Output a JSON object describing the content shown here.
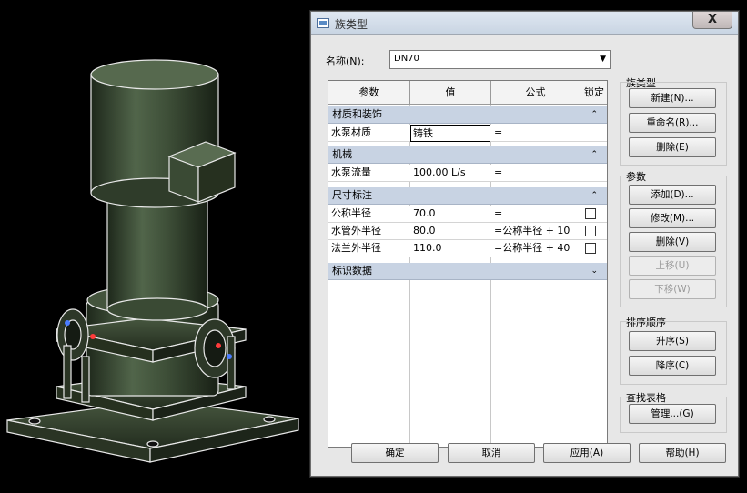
{
  "dialog": {
    "title": "族类型",
    "close_label": "X",
    "name_label": "名称(N):",
    "name_value": "DN70"
  },
  "grid": {
    "headers": [
      "参数",
      "值",
      "公式",
      "锁定"
    ],
    "groups": [
      {
        "label": "材质和装饰",
        "caret": "⌃"
      },
      {
        "label": "机械",
        "caret": "⌃"
      },
      {
        "label": "尺寸标注",
        "caret": "⌃"
      },
      {
        "label": "标识数据",
        "caret": "⌄"
      }
    ],
    "rows": [
      {
        "param": "水泵材质",
        "value": "铸铁",
        "formula": "="
      },
      {
        "param": "水泵流量",
        "value": "100.00 L/s",
        "formula": "="
      },
      {
        "param": "公称半径",
        "value": "70.0",
        "formula": "="
      },
      {
        "param": "水管外半径",
        "value": "80.0",
        "formula": "=公称半径 + 10"
      },
      {
        "param": "法兰外半径",
        "value": "110.0",
        "formula": "=公称半径 + 40"
      }
    ]
  },
  "side": {
    "family_types_label": "族类型",
    "new_label": "新建(N)...",
    "rename_label": "重命名(R)...",
    "delete_label": "删除(E)",
    "params_label": "参数",
    "add_label": "添加(D)...",
    "modify_label": "修改(M)...",
    "remove_label": "删除(V)",
    "move_up_label": "上移(U)",
    "move_down_label": "下移(W)",
    "sort_label": "排序顺序",
    "asc_label": "升序(S)",
    "desc_label": "降序(C)",
    "lookup_label": "查找表格",
    "manage_label": "管理...(G)"
  },
  "footer": {
    "ok_label": "确定",
    "cancel_label": "取消",
    "apply_label": "应用(A)",
    "help_label": "帮助(H)"
  },
  "colors": {
    "model_body": "#3a4a34",
    "model_edge": "#ffffff",
    "group_band": "#c8d3e3"
  }
}
